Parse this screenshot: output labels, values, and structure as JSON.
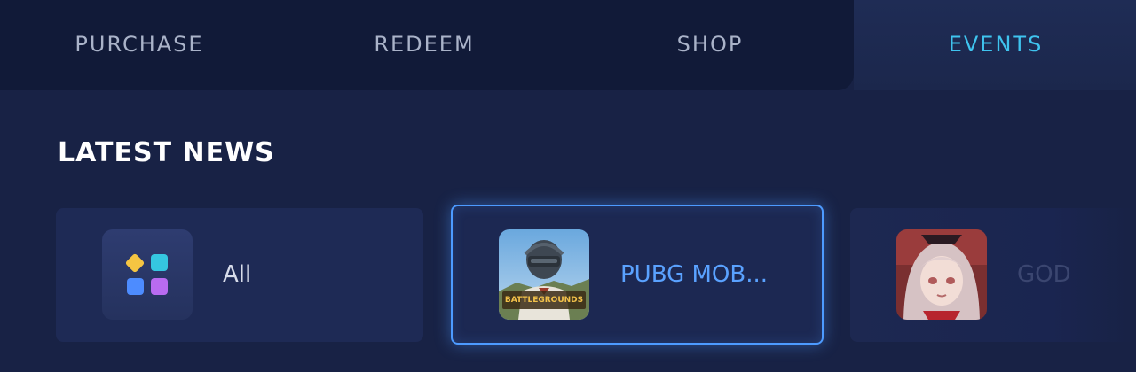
{
  "tabs": [
    {
      "label": "PURCHASE",
      "active": false
    },
    {
      "label": "REDEEM",
      "active": false
    },
    {
      "label": "SHOP",
      "active": false
    },
    {
      "label": "EVENTS",
      "active": true
    }
  ],
  "section": {
    "title": "LATEST NEWS"
  },
  "cards": [
    {
      "label": "All",
      "icon": "grid-apps-icon",
      "selected": false
    },
    {
      "label": "PUBG MOB...",
      "icon": "pubg-mobile-game-icon",
      "selected": true,
      "icon_text": "BATTLEGROUNDS"
    },
    {
      "label": "GOD",
      "icon": "anime-game-icon",
      "selected": false
    }
  ],
  "colors": {
    "background": "#182245",
    "tab_bar": "#111a38",
    "active_tab_text": "#3fc4ef",
    "selected_border": "#4d9bff",
    "selected_label": "#5aa2ff"
  }
}
